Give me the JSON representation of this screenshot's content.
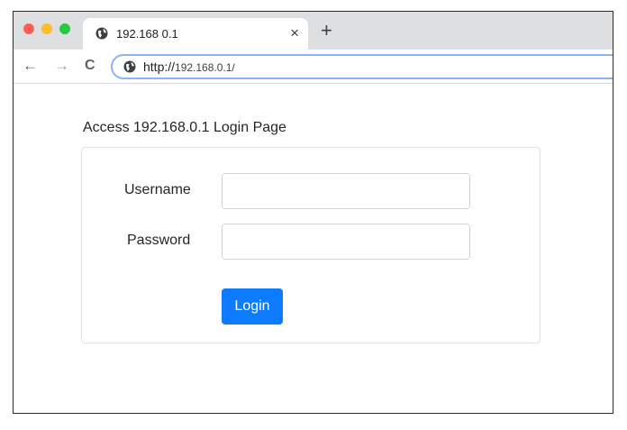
{
  "browser": {
    "tab_title": "192.168 0.1",
    "tab_close_glyph": "×",
    "new_tab_glyph": "+",
    "back_glyph": "←",
    "forward_glyph": "→",
    "reload_glyph": "C",
    "address_scheme": "http://",
    "address_host": "192.168.0.1/",
    "tab_icon": "globe-icon",
    "address_icon": "globe-icon"
  },
  "page": {
    "heading": "Access 192.168.0.1 Login Page"
  },
  "login_form": {
    "username_label": "Username",
    "username_value": "",
    "password_label": "Password",
    "password_value": "",
    "login_button_label": "Login"
  },
  "colors": {
    "primary_button": "#0d7bfd",
    "traffic_red": "#fe5f57",
    "traffic_yellow": "#febc2e",
    "traffic_green": "#28c840"
  }
}
